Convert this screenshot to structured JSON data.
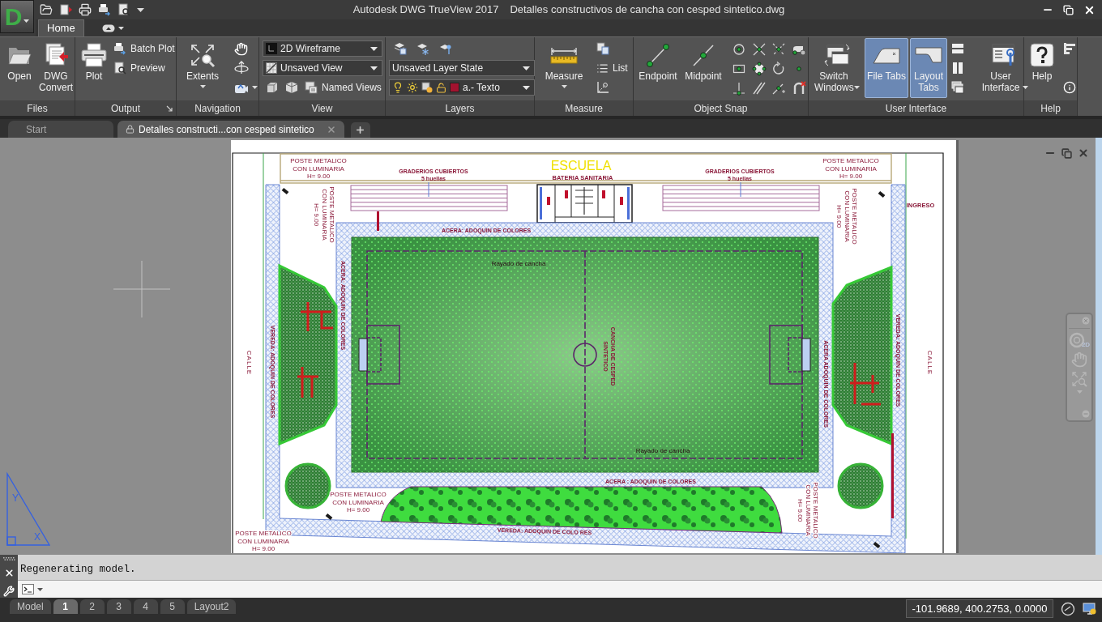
{
  "app_menu": {
    "letter": "D"
  },
  "title_bar": {
    "application": "Autodesk DWG TrueView 2017",
    "document": "Detalles constructivos de cancha con cesped sintetico.dwg"
  },
  "ribbon_tabs": [
    {
      "kind": "text",
      "label": "Home",
      "selected": true
    },
    {
      "kind": "icon",
      "selected": false
    }
  ],
  "ribbon": {
    "files": {
      "title": "Files",
      "open": "Open",
      "dwg_convert": "DWG Convert"
    },
    "output": {
      "title": "Output",
      "plot": "Plot",
      "batch_plot": "Batch Plot",
      "preview": "Preview"
    },
    "navigation": {
      "title": "Navigation",
      "extents": "Extents"
    },
    "view": {
      "title": "View",
      "visual_style": "2D Wireframe",
      "named_view": "Unsaved View",
      "named_views": "Named Views"
    },
    "layers": {
      "title": "Layers",
      "layer_state": "Unsaved Layer State",
      "current_layer": {
        "name": "a.- Texto",
        "color": "#a3122f"
      }
    },
    "measure": {
      "title": "Measure",
      "measure": "Measure",
      "list": "List"
    },
    "object_snap": {
      "title": "Object Snap",
      "endpoint": "Endpoint",
      "midpoint": "Midpoint"
    },
    "user_interface": {
      "title": "User Interface",
      "switch_windows": "Switch Windows",
      "file_tabs": {
        "label": "File Tabs",
        "on": true
      },
      "layout_tabs": {
        "label": "Layout Tabs",
        "on": true
      },
      "user_interface": "User Interface"
    },
    "help": {
      "title": "Help",
      "help": "Help"
    }
  },
  "file_tabs": [
    {
      "label": "Start",
      "selected": false,
      "locked": false
    },
    {
      "label": "Detalles constructi...con cesped sintetico",
      "selected": true,
      "locked": true
    }
  ],
  "drawing": {
    "school": "ESCUELA",
    "restrooms": "BATERIA SANITARIA",
    "bleacher_labels": [
      {
        "lines": [
          "GRADERIOS CUBIERTOS",
          "5 huellas"
        ]
      },
      {
        "lines": [
          "GRADERIOS CUBIERTOS",
          "5 huellas"
        ]
      }
    ],
    "entrance": "INGRESO",
    "field_label": {
      "lines": [
        "CANCHA DE CESPED",
        "SINTETICO"
      ]
    },
    "line_marking_labels": [
      "Rayado de cancha",
      "Rayado de cancha"
    ],
    "sidewalk_labels": [
      "ACERA: ADOQUIN DE COLORES",
      "ACERA: ADOQUIN DE COLORES",
      "ACERA ADOQUIN DE COLORES",
      "ACERA : ADOQUIN DE COLORES"
    ],
    "walkway_labels": [
      "VEREDA: ADOQUIN DE COLORES",
      "VEREDA: ADOQUIN DE COLORES",
      "VEREDA: ADOQUIN DE COLO RES"
    ],
    "street_labels": [
      "CALLE",
      "CALLE"
    ],
    "pole_labels": [
      {
        "lines": [
          "POSTE METALICO",
          "CON LUMINARIA",
          "H= 9.00"
        ]
      },
      {
        "lines": [
          "POSTE METALICO",
          "CON LUMINARIA",
          "H= 9.00"
        ]
      },
      {
        "lines": [
          "POSTE METALICO",
          "CON LUMINARIA",
          "H= 9.00"
        ]
      },
      {
        "lines": [
          "POSTE METALICO",
          "CON LUMINARIA",
          "H= 9.00"
        ]
      },
      {
        "lines": [
          "POSTE METALICO",
          "CON LUMINARIA",
          "H= 9.00"
        ]
      },
      {
        "lines": [
          "POSTE METALICO",
          "CON LUMINARIA",
          "H= 9.00"
        ]
      },
      {
        "lines": [
          "POSTE METALICO",
          "CON LUMINARIA",
          "H= 9.00"
        ]
      }
    ]
  },
  "navigation_bar": {
    "wheel_badge": "2D"
  },
  "ucs_icon": {
    "y_axis": "Y",
    "x_axis": "X"
  },
  "command_line": {
    "history": "Regenerating model."
  },
  "status_bar": {
    "layout_tabs": [
      {
        "label": "Model",
        "selected": false
      },
      {
        "label": "1",
        "selected": true
      },
      {
        "label": "2",
        "selected": false
      },
      {
        "label": "3",
        "selected": false
      },
      {
        "label": "4",
        "selected": false
      },
      {
        "label": "5",
        "selected": false
      },
      {
        "label": "Layout2",
        "selected": false
      }
    ],
    "coordinates": "-101.9689, 400.2753, 0.0000"
  }
}
